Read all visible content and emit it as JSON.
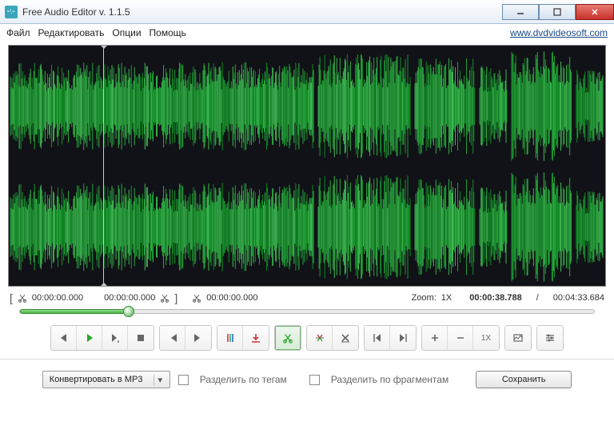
{
  "window": {
    "title": "Free Audio Editor v. 1.1.5"
  },
  "menubar": {
    "file": "Файл",
    "edit": "Редактировать",
    "options": "Опции",
    "help": "Помощь",
    "site_link": "www.dvdvideosoft.com"
  },
  "timerow": {
    "sel_start": "00:00:00.000",
    "sel_end": "00:00:00.000",
    "cursor": "00:00:00.000",
    "zoom_label": "Zoom:",
    "zoom_value": "1X",
    "position": "00:00:38.788",
    "sep": "/",
    "duration": "00:04:33.684"
  },
  "toolbar": {
    "zoom_1x": "1X"
  },
  "bottom": {
    "convert_label": "Конвертировать в MP3",
    "split_tags": "Разделить по тегам",
    "split_fragments": "Разделить по фрагментам",
    "save": "Сохранить"
  }
}
